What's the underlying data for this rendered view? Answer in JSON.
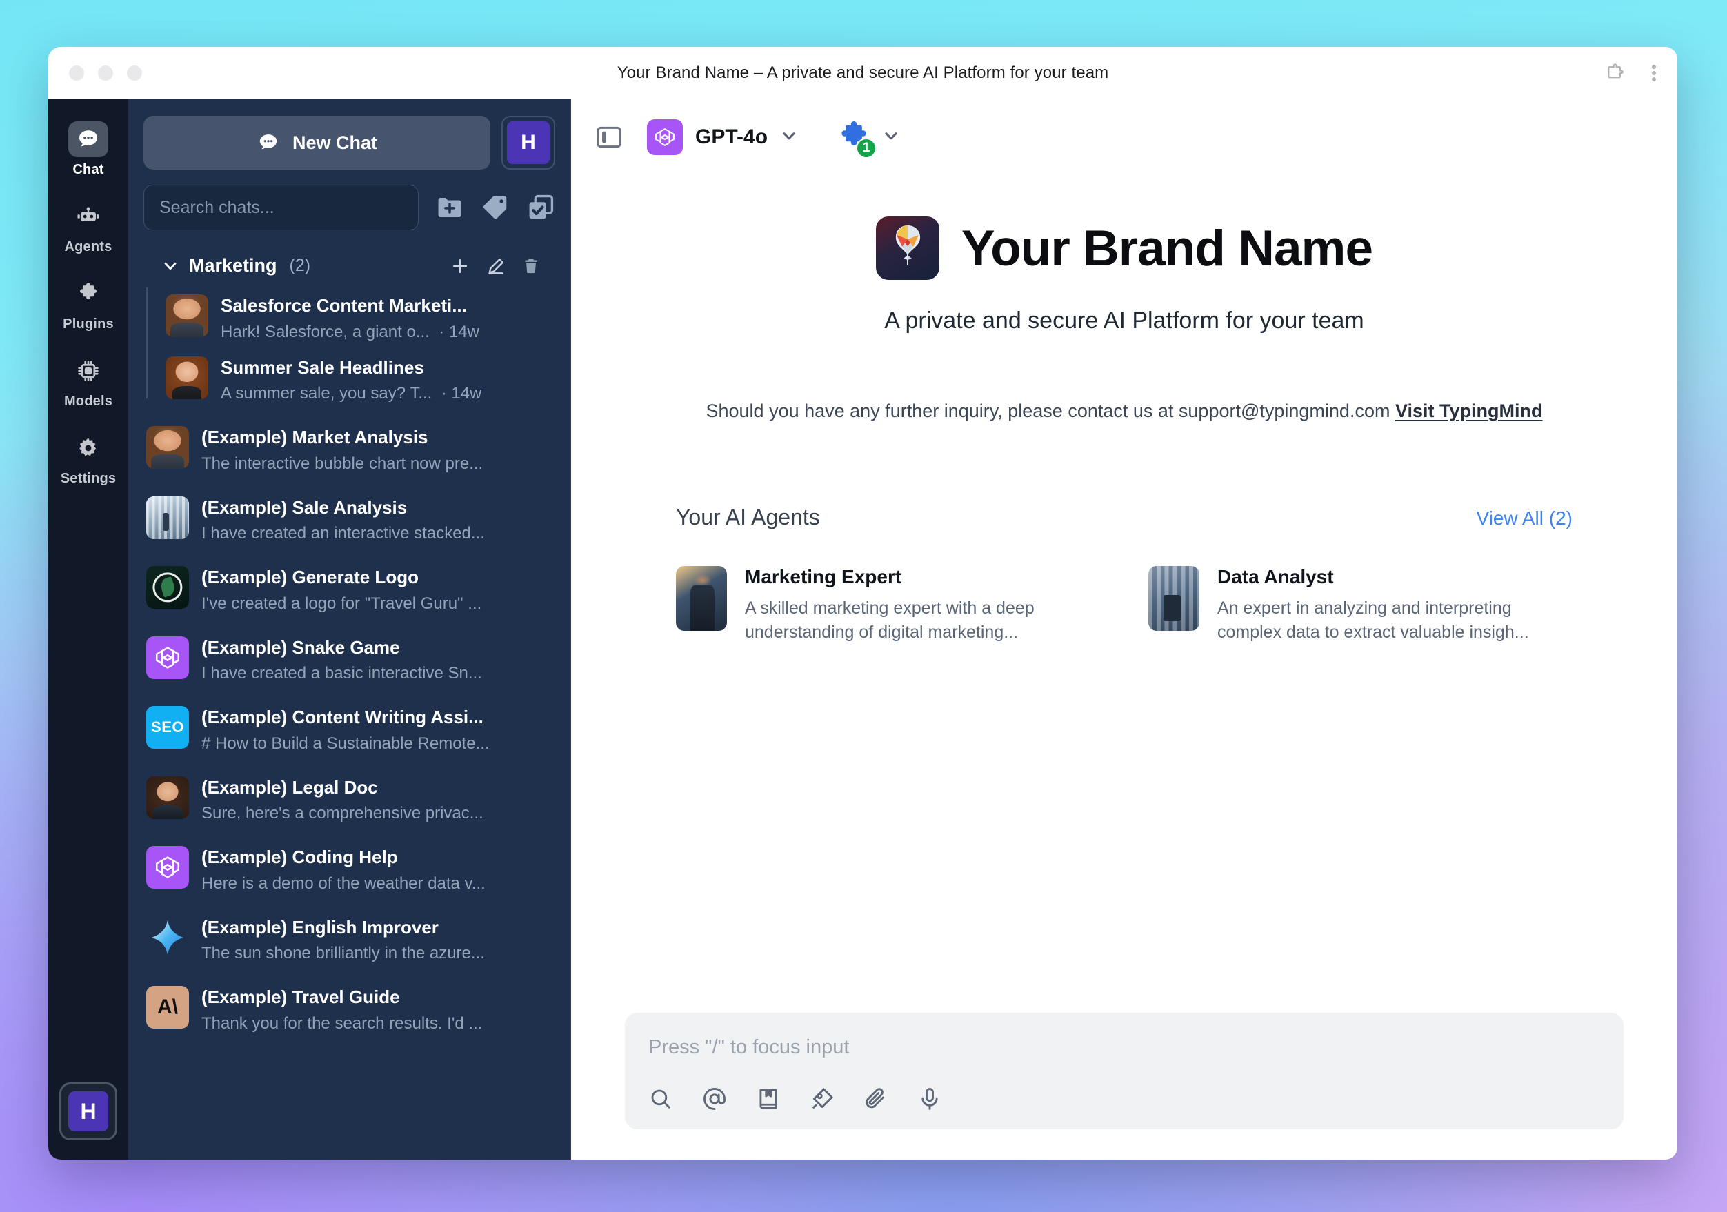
{
  "window": {
    "title": "Your Brand Name – A private and secure AI Platform for your team",
    "titlebar_icons": [
      "extension-puzzle-icon",
      "kebab-menu-icon"
    ]
  },
  "rail": {
    "items": [
      {
        "label": "Chat",
        "icon": "chat-bubble-icon",
        "active": true
      },
      {
        "label": "Agents",
        "icon": "robot-icon",
        "active": false
      },
      {
        "label": "Plugins",
        "icon": "puzzle-piece-icon",
        "active": false
      },
      {
        "label": "Models",
        "icon": "chip-icon",
        "active": false
      },
      {
        "label": "Settings",
        "icon": "gear-icon",
        "active": false
      }
    ],
    "bottom_avatar": "H"
  },
  "sidebar": {
    "new_chat_label": "New Chat",
    "avatar_initial": "H",
    "search_placeholder": "Search chats...",
    "toolbar_icons": [
      "folder-plus-icon",
      "tag-icon",
      "multi-select-icon"
    ],
    "folder": {
      "name": "Marketing",
      "count": "(2)",
      "expanded": true,
      "action_icons": [
        "plus-icon",
        "pencil-icon",
        "trash-icon"
      ],
      "chats": [
        {
          "title": "Salesforce Content Marketi...",
          "preview": "Hark! Salesforce, a giant o...",
          "time": "14w",
          "thumb": "th-man"
        },
        {
          "title": "Summer Sale Headlines",
          "preview": "A summer sale, you say? T...",
          "time": "14w",
          "thumb": "th-woman"
        }
      ]
    },
    "chats": [
      {
        "title": "(Example) Market Analysis",
        "preview": "The interactive bubble chart now pre...",
        "thumb": "th-man"
      },
      {
        "title": "(Example) Sale Analysis",
        "preview": "I have created an interactive stacked...",
        "thumb": "th-office"
      },
      {
        "title": "(Example) Generate Logo",
        "preview": "I've created a logo for \"Travel Guru\" ...",
        "thumb": "th-logo"
      },
      {
        "title": "(Example) Snake Game",
        "preview": "I have created a basic interactive Sn...",
        "thumb": "th-gpt"
      },
      {
        "title": "(Example) Content Writing Assi...",
        "preview": "# How to Build a Sustainable Remote...",
        "thumb": "th-seo",
        "thumb_text": "SEO"
      },
      {
        "title": "(Example) Legal Doc",
        "preview": "Sure, here's a comprehensive privac...",
        "thumb": "th-woman2"
      },
      {
        "title": "(Example) Coding Help",
        "preview": "Here is a demo of the weather data v...",
        "thumb": "th-gpt"
      },
      {
        "title": "(Example) English Improver",
        "preview": "The sun shone brilliantly in the azure...",
        "thumb": "th-gemini"
      },
      {
        "title": "(Example) Travel Guide",
        "preview": "Thank you for the search results. I'd ...",
        "thumb": "th-claude",
        "thumb_text": "A\\"
      }
    ]
  },
  "toolbar": {
    "sidebar_toggle_icon": "panel-toggle-icon",
    "model_name": "GPT-4o",
    "model_icon": "openai-icon",
    "model_chevron_icon": "chevron-down-icon",
    "plugin_icon": "puzzle-piece-icon",
    "plugin_count": "1",
    "plugin_chevron_icon": "chevron-down-icon"
  },
  "welcome": {
    "brand_title": "Your Brand Name",
    "brand_logo_icon": "brain-logo-icon",
    "subtitle": "A private and secure AI Platform for your team",
    "contact_text": "Should you have any further inquiry, please contact us at support@typingmind.com",
    "contact_link": "Visit TypingMind"
  },
  "agents_section": {
    "title": "Your AI Agents",
    "view_all": "View All (2)",
    "agents": [
      {
        "name": "Marketing Expert",
        "description": "A skilled marketing expert with a deep understanding of digital marketing...",
        "thumb": "ag-marketing"
      },
      {
        "name": "Data Analyst",
        "description": "An expert in analyzing and interpreting complex data to extract valuable insigh...",
        "thumb": "ag-data"
      }
    ]
  },
  "composer": {
    "placeholder": "Press \"/\" to focus input",
    "value": "",
    "tool_icons": [
      "search-icon",
      "at-mention-icon",
      "prompt-library-icon",
      "pen-nib-icon",
      "paperclip-icon",
      "microphone-icon"
    ]
  },
  "colors": {
    "accent_purple": "#4c35b5",
    "link_blue": "#3b82f6",
    "badge_green": "#16a34a",
    "sidebar_bg": "#1e304c",
    "rail_bg": "#111827"
  }
}
